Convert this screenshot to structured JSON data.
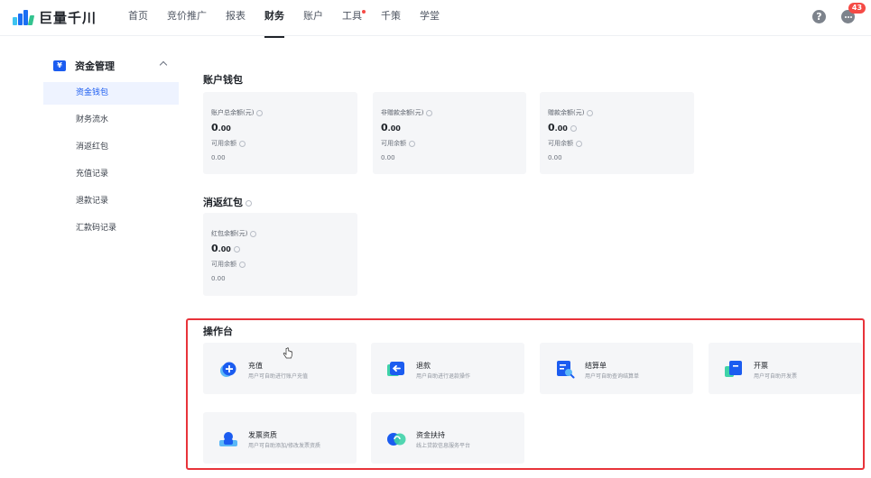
{
  "brand": {
    "name": "巨量千川"
  },
  "nav": {
    "items": [
      {
        "label": "首页",
        "active": false
      },
      {
        "label": "竞价推广",
        "active": false
      },
      {
        "label": "报表",
        "active": false
      },
      {
        "label": "财务",
        "active": true
      },
      {
        "label": "账户",
        "active": false
      },
      {
        "label": "工具",
        "active": false,
        "dot": true
      },
      {
        "label": "千策",
        "active": false
      },
      {
        "label": "学堂",
        "active": false
      }
    ]
  },
  "header": {
    "help_label": "?",
    "message_badge": "43"
  },
  "sidebar": {
    "group_icon": "¥",
    "group_label": "资金管理",
    "items": [
      {
        "label": "资金钱包",
        "active": true
      },
      {
        "label": "财务流水",
        "active": false
      },
      {
        "label": "消返红包",
        "active": false
      },
      {
        "label": "充值记录",
        "active": false
      },
      {
        "label": "退款记录",
        "active": false
      },
      {
        "label": "汇款码记录",
        "active": false
      }
    ]
  },
  "wallet": {
    "title": "账户钱包",
    "cards": [
      {
        "label": "账户总余额(元)",
        "amount_int": "0",
        "amount_dec": ".00",
        "sub_label": "可用余额",
        "sub_value": "0.00"
      },
      {
        "label": "非赠款余额(元)",
        "amount_int": "0",
        "amount_dec": ".00",
        "sub_label": "可用余额",
        "sub_value": "0.00"
      },
      {
        "label": "赠款余额(元)",
        "amount_int": "0",
        "amount_dec": ".00",
        "sub_label": "可用余额",
        "sub_value": "0.00"
      }
    ]
  },
  "redpacket": {
    "title": "消返红包",
    "card": {
      "label": "红包余额(元)",
      "amount_int": "0",
      "amount_dec": ".00",
      "sub_label": "可用余额",
      "sub_value": "0.00"
    }
  },
  "operations": {
    "title": "操作台",
    "items": [
      {
        "title": "充值",
        "desc": "用户可自助进行账户充值",
        "icon": "recharge-icon"
      },
      {
        "title": "退款",
        "desc": "用户自助进行退款操作",
        "icon": "refund-icon"
      },
      {
        "title": "结算单",
        "desc": "用户可自助查询结算单",
        "icon": "statement-icon"
      },
      {
        "title": "开票",
        "desc": "用户可自助开发票",
        "icon": "invoice-icon"
      },
      {
        "title": "发票资质",
        "desc": "用户可自助添加/修改发票资质",
        "icon": "invoice-qualification-icon"
      },
      {
        "title": "资金扶持",
        "desc": "线上贷款信息服务平台",
        "icon": "funding-support-icon"
      }
    ]
  },
  "colors": {
    "accent": "#1b5cf0",
    "highlight_frame": "#e8333a",
    "badge": "#f54a45",
    "card_bg": "#f5f6f8"
  }
}
